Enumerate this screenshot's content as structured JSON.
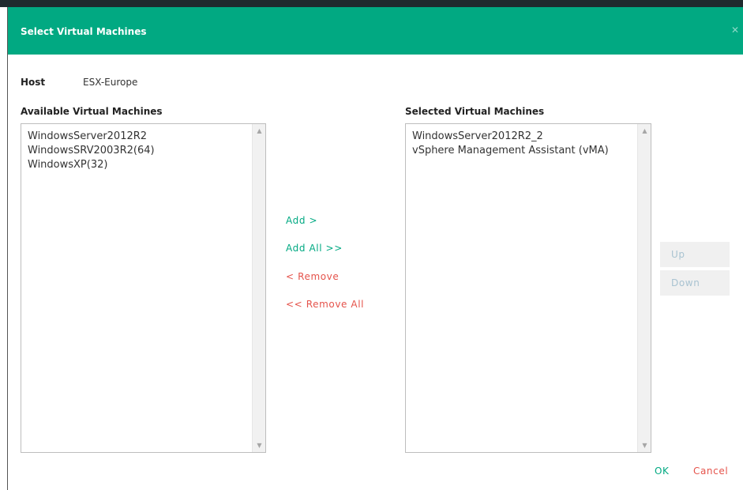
{
  "dialog": {
    "title": "Select Virtual Machines",
    "close_icon": "close-icon"
  },
  "host": {
    "label": "Host",
    "value": "ESX-Europe"
  },
  "available": {
    "title": "Available Virtual Machines",
    "items": [
      {
        "label": "WindowsServer2012R2"
      },
      {
        "label": "WindowsSRV2003R2(64)"
      },
      {
        "label": "WindowsXP(32)"
      }
    ]
  },
  "selected": {
    "title": "Selected Virtual Machines",
    "items": [
      {
        "label": "WindowsServer2012R2_2"
      },
      {
        "label": "vSphere Management Assistant (vMA)"
      }
    ]
  },
  "actions": {
    "add": "Add >",
    "add_all": "Add All >>",
    "remove": "< Remove",
    "remove_all": "<< Remove All"
  },
  "order": {
    "up": "Up",
    "down": "Down"
  },
  "footer": {
    "ok": "OK",
    "cancel": "Cancel"
  },
  "colors": {
    "header": "#01a982",
    "accent_green": "#01a982",
    "accent_red": "#e5534b",
    "disabled_text": "#a9c3d1"
  }
}
